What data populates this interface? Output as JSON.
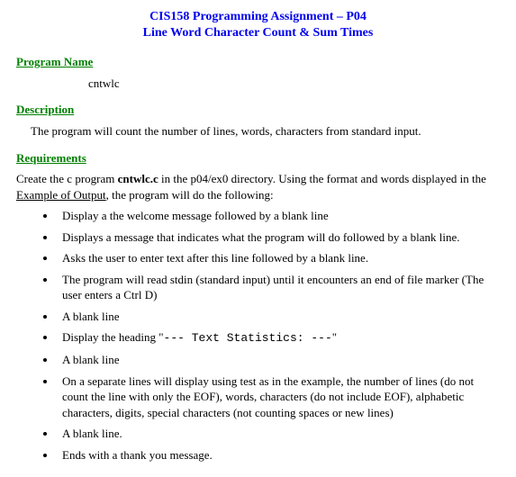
{
  "title": {
    "line1": "CIS158 Programming Assignment – P04",
    "line2": "Line Word Character Count & Sum Times"
  },
  "programName": {
    "heading": "Program Name",
    "value": "cntwlc"
  },
  "description": {
    "heading": "Description",
    "text": "The program will count the number of lines, words, characters from standard input."
  },
  "requirements": {
    "heading": "Requirements",
    "intro_pre": "Create the c program ",
    "intro_bold": "cntwlc.c",
    "intro_mid": " in the p04/ex0  directory.  Using the format and words displayed in the ",
    "intro_link": "Example of Output",
    "intro_post": ", the program will do the following:",
    "items": [
      "Display a the welcome message followed by a blank line",
      "Displays a message that indicates what the program will do followed by a blank line.",
      "Asks the user to enter text after this line followed by a blank line.",
      "The program will read stdin (standard input) until it encounters an end of file marker (The user enters a Ctrl D)",
      "A blank line"
    ],
    "heading_item": {
      "pre": "Display the heading \"",
      "code": "---    Text Statistics:       ---",
      "post": "\""
    },
    "items2": [
      "A blank line",
      "On a separate lines will display using test as in the example, the number of lines (do not count the line with only the EOF), words, characters (do not include EOF), alphabetic characters, digits, special characters (not counting spaces or new lines)",
      "A blank line.",
      "Ends with a thank you message."
    ]
  }
}
